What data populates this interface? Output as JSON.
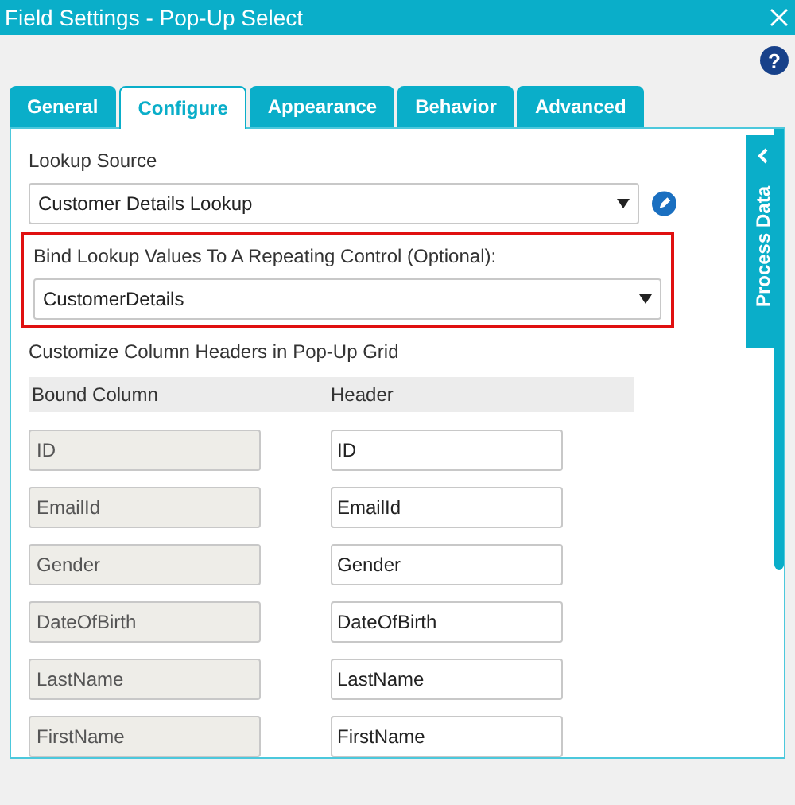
{
  "window": {
    "title": "Field Settings - Pop-Up Select"
  },
  "help_button": {
    "glyph": "?"
  },
  "tabs": [
    {
      "label": "General",
      "selected": false
    },
    {
      "label": "Configure",
      "selected": true
    },
    {
      "label": "Appearance",
      "selected": false
    },
    {
      "label": "Behavior",
      "selected": false
    },
    {
      "label": "Advanced",
      "selected": false
    }
  ],
  "lookup_source": {
    "label": "Lookup Source",
    "value": "Customer Details Lookup"
  },
  "bind_repeating": {
    "label": "Bind Lookup Values To A Repeating Control (Optional):",
    "value": "CustomerDetails",
    "highlighted": true
  },
  "grid_headers": {
    "label": "Customize Column Headers in Pop-Up Grid",
    "columns": [
      "Bound Column",
      "Header"
    ],
    "rows": [
      {
        "bound": "ID",
        "header": "ID"
      },
      {
        "bound": "EmailId",
        "header": "EmailId"
      },
      {
        "bound": "Gender",
        "header": "Gender"
      },
      {
        "bound": "DateOfBirth",
        "header": "DateOfBirth"
      },
      {
        "bound": "LastName",
        "header": "LastName"
      },
      {
        "bound": "FirstName",
        "header": "FirstName"
      }
    ]
  },
  "side_panel": {
    "label": "Process Data"
  }
}
